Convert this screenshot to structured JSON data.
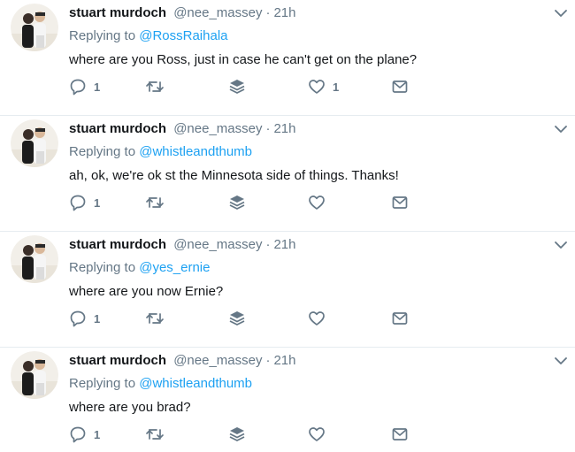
{
  "tweets": [
    {
      "name": "stuart murdoch",
      "handle": "@nee_massey",
      "dot": "·",
      "time": "21h",
      "replying_prefix": "Replying to ",
      "replying_to": "@RossRaihala",
      "text": "where are you Ross, just in case he can't get on the plane?",
      "reply_count": "1",
      "like_count": "1"
    },
    {
      "name": "stuart murdoch",
      "handle": "@nee_massey",
      "dot": "·",
      "time": "21h",
      "replying_prefix": "Replying to ",
      "replying_to": "@whistleandthumb",
      "text": "ah, ok, we're ok st the Minnesota side of things. Thanks!",
      "reply_count": "1",
      "like_count": ""
    },
    {
      "name": "stuart murdoch",
      "handle": "@nee_massey",
      "dot": "·",
      "time": "21h",
      "replying_prefix": "Replying to ",
      "replying_to": "@yes_ernie",
      "text": "where are you now Ernie?",
      "reply_count": "1",
      "like_count": ""
    },
    {
      "name": "stuart murdoch",
      "handle": "@nee_massey",
      "dot": "·",
      "time": "21h",
      "replying_prefix": "Replying to ",
      "replying_to": "@whistleandthumb",
      "text": "where are you brad?",
      "reply_count": "1",
      "like_count": ""
    }
  ],
  "icons": {
    "reply": "reply-icon",
    "retweet": "retweet-icon",
    "stack": "layers-icon",
    "like": "heart-icon",
    "dm": "envelope-icon",
    "menu": "chevron-down-icon"
  },
  "colors": {
    "name": "#14171a",
    "secondary": "#657786",
    "mention": "#1da1f2",
    "divider": "#e6ecf0"
  }
}
